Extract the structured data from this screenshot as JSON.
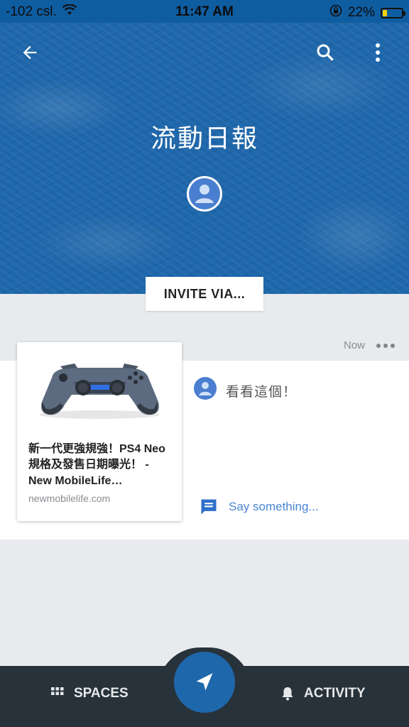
{
  "status_bar": {
    "carrier": "-102 csl.",
    "time": "11:47 AM",
    "battery_percent": "22%",
    "battery_level": 0.22
  },
  "header": {
    "title": "流動日報",
    "invite_label": "INVITE VIA..."
  },
  "post": {
    "time": "Now",
    "link": {
      "title": "新一代更強規強！PS4 Neo 規格及發售日期曝光！ - New MobileLife…",
      "domain": "newmobilelife.com"
    },
    "comment": "看看這個！",
    "reply_placeholder": "Say something..."
  },
  "bottom_nav": {
    "spaces_label": "SPACES",
    "activity_label": "ACTIVITY"
  },
  "colors": {
    "header_blue": "#1e67ab",
    "nav_dark": "#27323a",
    "accent_blue": "#4a86d4"
  }
}
